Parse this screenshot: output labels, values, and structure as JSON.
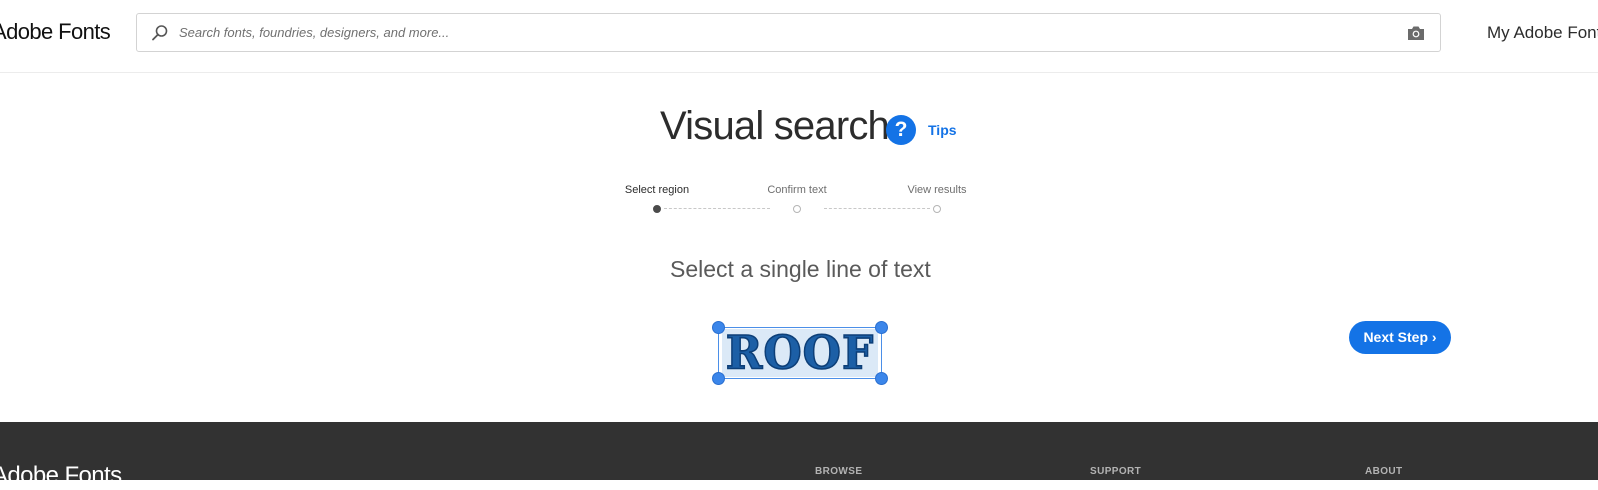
{
  "header": {
    "brand": "Adobe Fonts",
    "search_placeholder": "Search fonts, foundries, designers, and more...",
    "account_link": "My Adobe Fonts"
  },
  "main": {
    "title": "Visual search",
    "tips_label": "Tips",
    "steps": [
      {
        "label": "Select region",
        "active": true
      },
      {
        "label": "Confirm text",
        "active": false
      },
      {
        "label": "View results",
        "active": false
      }
    ],
    "instruction": "Select a single line of text",
    "selected_image_text": "ROOF",
    "next_button": "Next Step ›"
  },
  "footer": {
    "brand": "Adobe Fonts",
    "columns": [
      "BROWSE",
      "SUPPORT",
      "ABOUT"
    ]
  },
  "colors": {
    "accent": "#1473e6",
    "footer_bg": "#323232"
  },
  "icons": {
    "search": "search-icon",
    "camera": "camera-icon",
    "help": "help-icon"
  }
}
